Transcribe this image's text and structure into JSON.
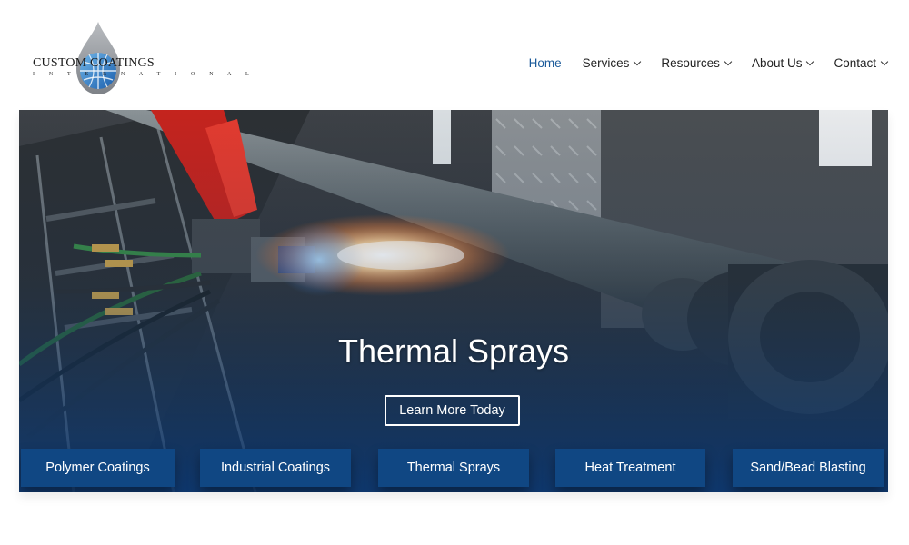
{
  "logo": {
    "name": "CUSTOM COATINGS",
    "subtitle": "I N T E R N A T I O N A L"
  },
  "nav": {
    "items": [
      {
        "label": "Home",
        "active": true,
        "has_dropdown": false
      },
      {
        "label": "Services",
        "active": false,
        "has_dropdown": true
      },
      {
        "label": "Resources",
        "active": false,
        "has_dropdown": true
      },
      {
        "label": "About Us",
        "active": false,
        "has_dropdown": true
      },
      {
        "label": "Contact",
        "active": false,
        "has_dropdown": true
      }
    ]
  },
  "hero": {
    "title": "Thermal Sprays",
    "button_label": "Learn More Today"
  },
  "services": [
    {
      "label": "Polymer Coatings"
    },
    {
      "label": "Industrial Coatings"
    },
    {
      "label": "Thermal Sprays"
    },
    {
      "label": "Heat Treatment"
    },
    {
      "label": "Sand/Bead Blasting"
    }
  ],
  "colors": {
    "accent_blue": "#1a5a9a",
    "button_blue": "#104783",
    "nav_text": "#222222"
  }
}
